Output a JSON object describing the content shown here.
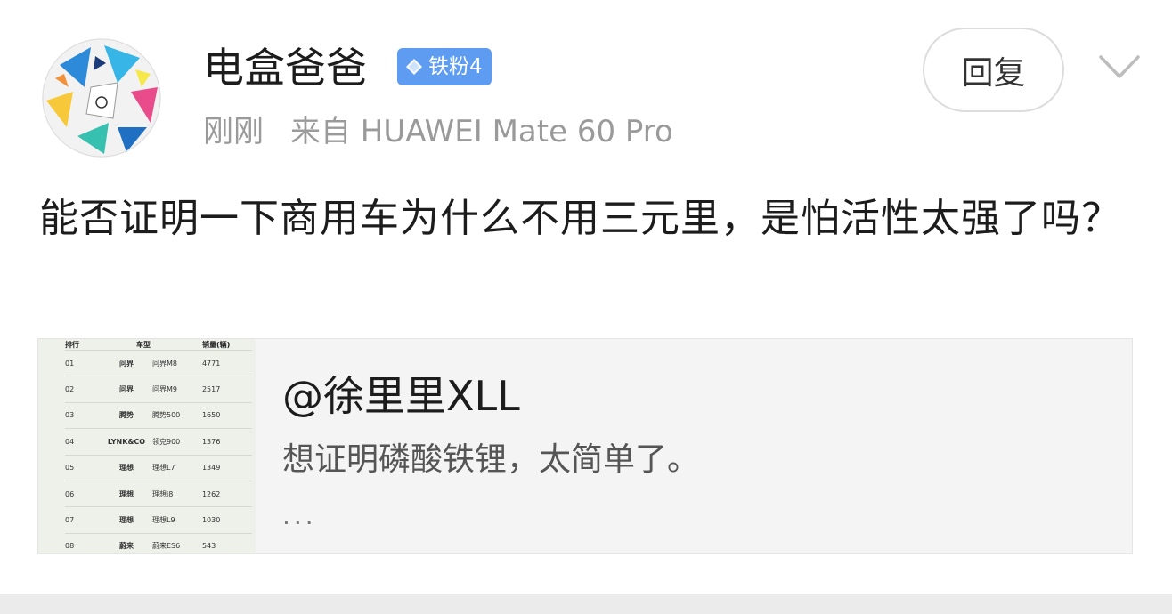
{
  "post": {
    "username": "电盒爸爸",
    "badge": {
      "label": "铁粉4",
      "icon": "diamond-icon",
      "color": "#5e9cf2"
    },
    "time": "刚刚",
    "source": "来自 HUAWEI Mate 60 Pro",
    "content": "能否证明一下商用车为什么不用三元里，是怕活性太强了吗？"
  },
  "actions": {
    "reply_label": "回复",
    "more_icon": "chevron-down-icon"
  },
  "quote": {
    "author": "@徐里里XLL",
    "text": "想证明磷酸铁锂，太简单了。",
    "ellipsis": "...",
    "thumbnail": {
      "headers": [
        "排行",
        "车型",
        "销量(辆)"
      ],
      "rows": [
        {
          "rank": "01",
          "logo": "问界",
          "model": "问界M8",
          "sales": "4771"
        },
        {
          "rank": "02",
          "logo": "问界",
          "model": "问界M9",
          "sales": "2517"
        },
        {
          "rank": "03",
          "logo": "腾势",
          "model": "腾势500",
          "sales": "1650"
        },
        {
          "rank": "04",
          "logo": "LYNK&CO",
          "model": "领克900",
          "sales": "1376"
        },
        {
          "rank": "05",
          "logo": "理想",
          "model": "理想L7",
          "sales": "1349"
        },
        {
          "rank": "06",
          "logo": "理想",
          "model": "理想i8",
          "sales": "1262"
        },
        {
          "rank": "07",
          "logo": "理想",
          "model": "理想L9",
          "sales": "1030"
        },
        {
          "rank": "08",
          "logo": "蔚来",
          "model": "蔚来ES6",
          "sales": "543"
        }
      ]
    }
  }
}
